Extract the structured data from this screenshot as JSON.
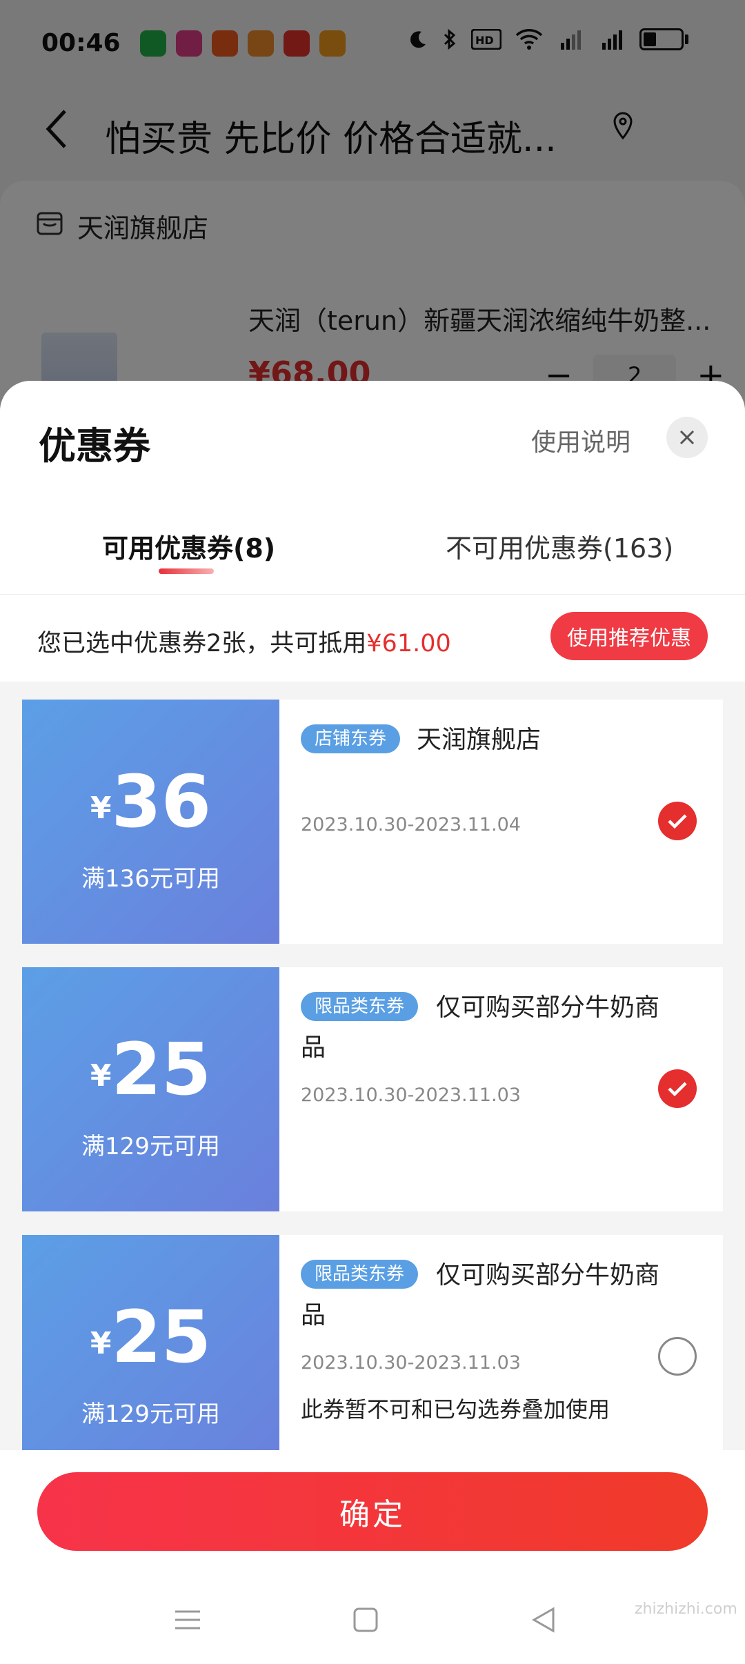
{
  "status_bar": {
    "time": "00:46"
  },
  "nav": {
    "title": "怕买贵 先比价 价格合适就..."
  },
  "store": {
    "name": "天润旗舰店"
  },
  "product": {
    "title": "天润（terun）新疆天润浓缩纯牛奶整...",
    "price": "¥68.00",
    "quantity": "2"
  },
  "sheet": {
    "title": "优惠券",
    "usage_link": "使用说明",
    "tabs": [
      {
        "label": "可用优惠券(8)",
        "active": true
      },
      {
        "label": "不可用优惠券(163)",
        "active": false
      }
    ],
    "summary_prefix": "您已选中优惠券2张，共可抵用",
    "summary_amount": "¥61.00",
    "recommend_label": "使用推荐优惠"
  },
  "coupons": [
    {
      "yen": "¥",
      "value": "36",
      "threshold": "满136元可用",
      "tag": "店铺东券",
      "desc_line1": "天润旗舰店",
      "desc_line2": "",
      "date": "2023.10.30-2023.11.04",
      "note": "",
      "selected": true
    },
    {
      "yen": "¥",
      "value": "25",
      "threshold": "满129元可用",
      "tag": "限品类东券",
      "desc_line1": "仅可购买部分牛奶商",
      "desc_line2": "品",
      "date": "2023.10.30-2023.11.03",
      "note": "",
      "selected": true
    },
    {
      "yen": "¥",
      "value": "25",
      "threshold": "满129元可用",
      "tag": "限品类东券",
      "desc_line1": "仅可购买部分牛奶商",
      "desc_line2": "品",
      "date": "2023.10.30-2023.11.03",
      "note": "此券暂不可和已勾选券叠加使用",
      "selected": false
    }
  ],
  "confirm_label": "确定",
  "watermark": "zhizhizhi.com",
  "colors": {
    "accent_red": "#e52e2e",
    "coupon_blue": "#5c9fe6",
    "tag_blue": "#5a9fe3"
  }
}
